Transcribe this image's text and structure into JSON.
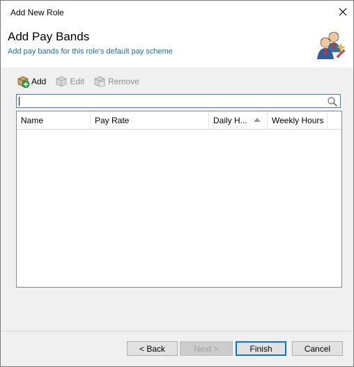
{
  "window": {
    "title": "Add New Role"
  },
  "header": {
    "title": "Add Pay Bands",
    "subtitle": "Add pay bands for this role's default pay scheme"
  },
  "toolbar": {
    "add_label": "Add",
    "edit_label": "Edit",
    "remove_label": "Remove"
  },
  "search": {
    "value": ""
  },
  "grid": {
    "columns": [
      "Name",
      "Pay Rate",
      "Daily H...",
      "Weekly Hours"
    ],
    "rows": []
  },
  "buttons": {
    "back": "< Back",
    "next": "Next >",
    "finish": "Finish",
    "cancel": "Cancel"
  },
  "colors": {
    "subtitle": "#1a6fb5",
    "default_button_border": "#0078d7",
    "search_border": "#3c7fb1"
  }
}
